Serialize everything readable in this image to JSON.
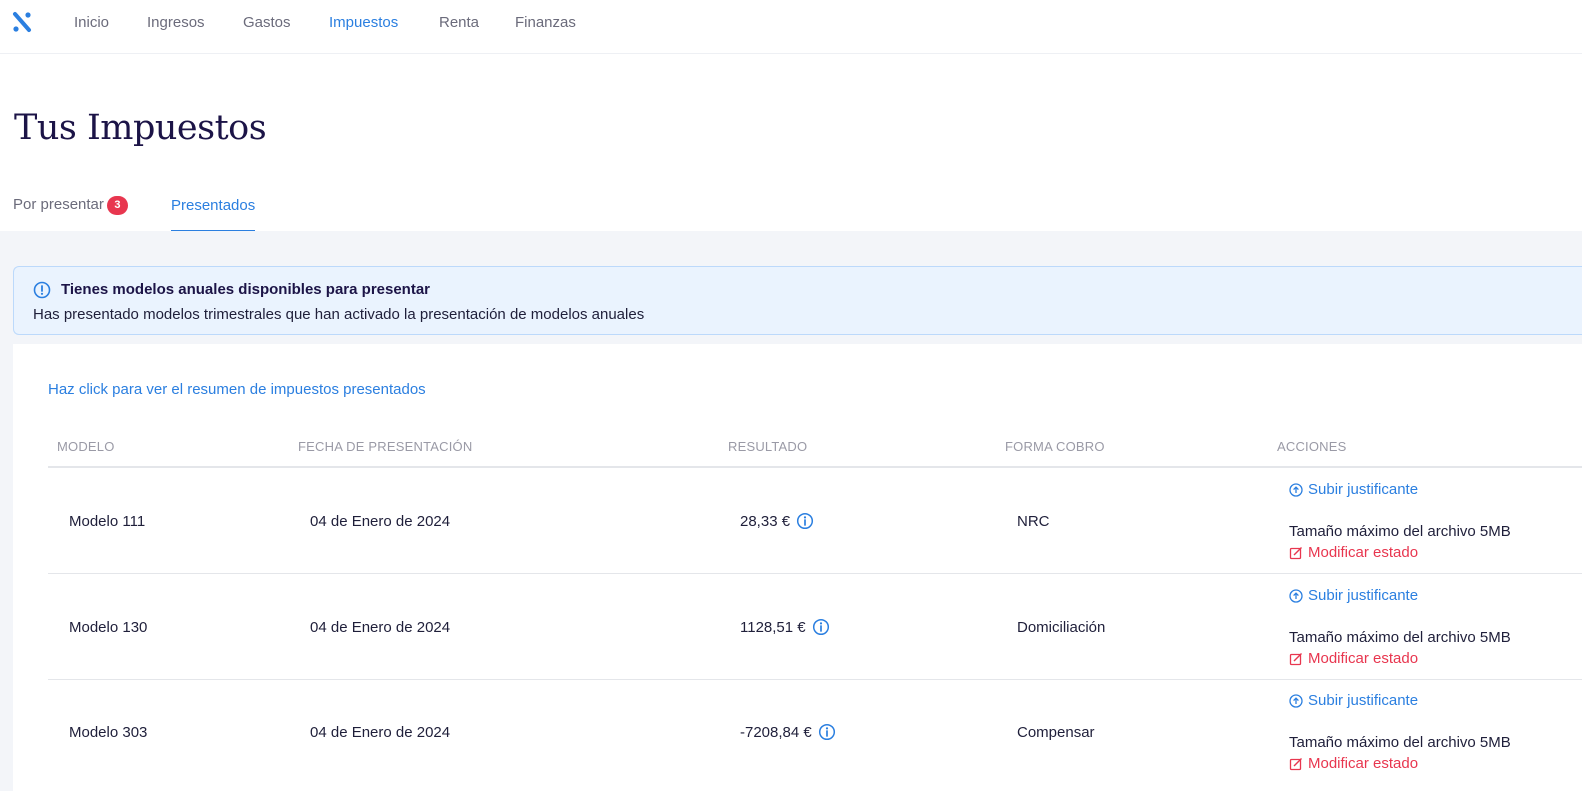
{
  "nav": {
    "items": [
      {
        "label": "Inicio",
        "active": false
      },
      {
        "label": "Ingresos",
        "active": false
      },
      {
        "label": "Gastos",
        "active": false
      },
      {
        "label": "Impuestos",
        "active": true
      },
      {
        "label": "Renta",
        "active": false
      },
      {
        "label": "Finanzas",
        "active": false
      }
    ]
  },
  "page": {
    "title": "Tus Impuestos"
  },
  "tabs": {
    "pending_label": "Por presentar",
    "pending_count": "3",
    "done_label": "Presentados"
  },
  "alert": {
    "title": "Tienes modelos anuales disponibles para presentar",
    "text": "Has presentado modelos trimestrales que han activado la presentación de modelos anuales"
  },
  "summary_link": "Haz click para ver el resumen de impuestos presentados",
  "table": {
    "headers": {
      "modelo": "MODELO",
      "fecha": "FECHA DE PRESENTACIÓN",
      "resultado": "RESULTADO",
      "forma": "FORMA COBRO",
      "acciones": "ACCIONES"
    },
    "rows": [
      {
        "modelo": "Modelo 111",
        "fecha": "04 de Enero de 2024",
        "resultado": "28,33 €",
        "forma": "NRC"
      },
      {
        "modelo": "Modelo 130",
        "fecha": "04 de Enero de 2024",
        "resultado": "1128,51 €",
        "forma": "Domiciliación"
      },
      {
        "modelo": "Modelo 303",
        "fecha": "04 de Enero de 2024",
        "resultado": "-7208,84 €",
        "forma": "Compensar"
      }
    ],
    "upload_label": "Subir justificante",
    "size_note": "Tamaño máximo del archivo 5MB",
    "modify_label": "Modificar estado"
  },
  "colors": {
    "accent": "#2b7fe0",
    "danger": "#e8364f",
    "title": "#1c1447"
  }
}
